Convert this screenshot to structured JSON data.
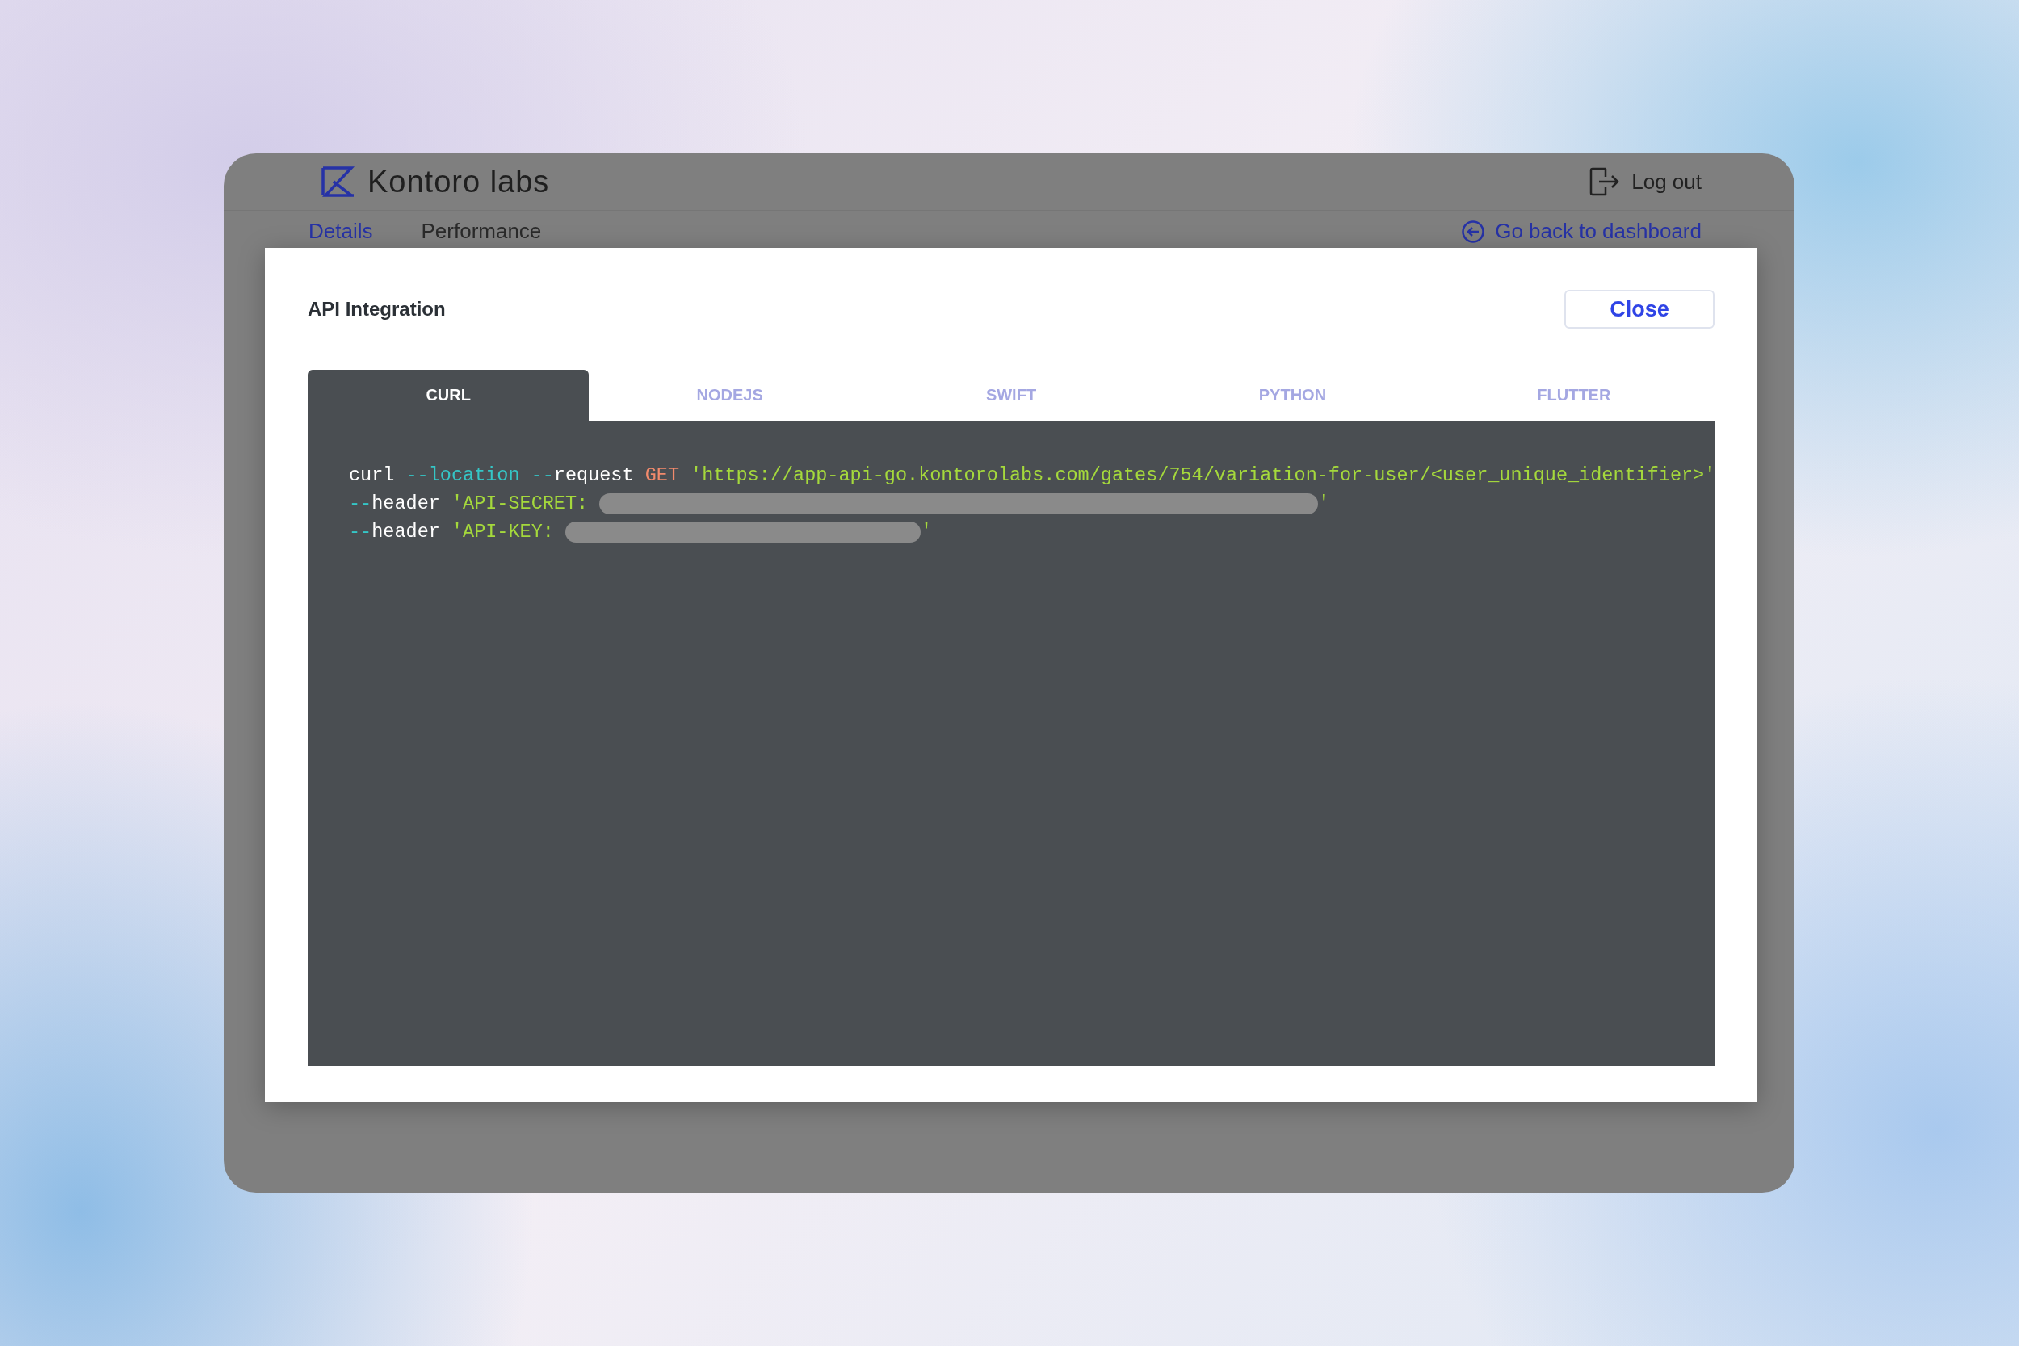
{
  "header": {
    "brand": "Kontoro labs",
    "logout": "Log out"
  },
  "subnav": {
    "tabs": [
      {
        "label": "Details",
        "selected": true
      },
      {
        "label": "Performance",
        "selected": false
      }
    ],
    "back_link": "Go back to dashboard"
  },
  "modal": {
    "title": "API Integration",
    "close": "Close",
    "tabs": [
      {
        "label": "CURL",
        "selected": true
      },
      {
        "label": "NODEJS",
        "selected": false
      },
      {
        "label": "SWIFT",
        "selected": false
      },
      {
        "label": "PYTHON",
        "selected": false
      },
      {
        "label": "FLUTTER",
        "selected": false
      }
    ],
    "code_lines": [
      {
        "tokens": [
          {
            "kind": "plain",
            "text": "curl "
          },
          {
            "kind": "flag",
            "text": "--location --"
          },
          {
            "kind": "plain",
            "text": "request "
          },
          {
            "kind": "method",
            "text": "GET "
          },
          {
            "kind": "string",
            "text": "'https://app-api-go.kontorolabs.com/gates/754/variation-for-user/<user_unique_identifier>'"
          }
        ]
      },
      {
        "tokens": [
          {
            "kind": "flag",
            "text": "--"
          },
          {
            "kind": "plain",
            "text": "header "
          },
          {
            "kind": "string",
            "text": "'API-SECRET: "
          },
          {
            "kind": "redacted_long"
          },
          {
            "kind": "string",
            "text": "'"
          }
        ]
      },
      {
        "tokens": [
          {
            "kind": "flag",
            "text": "--"
          },
          {
            "kind": "plain",
            "text": "header "
          },
          {
            "kind": "string",
            "text": "'API-KEY: "
          },
          {
            "kind": "redacted_short"
          },
          {
            "kind": "string",
            "text": "'"
          }
        ]
      }
    ]
  }
}
